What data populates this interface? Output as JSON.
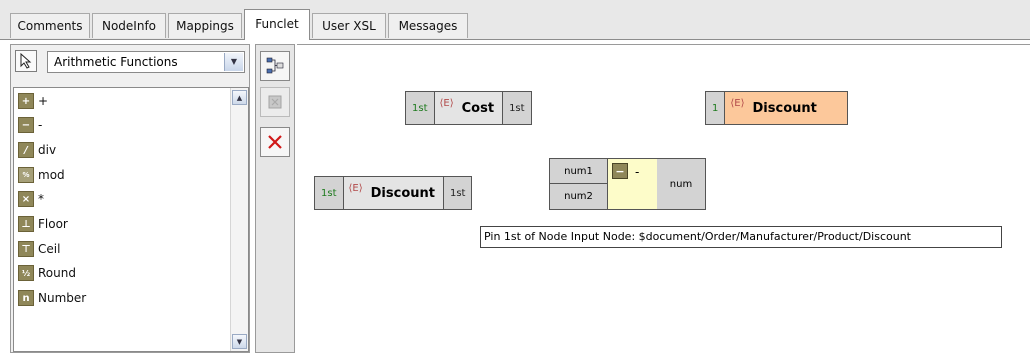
{
  "tabs": [
    {
      "label": "Comments",
      "active": false
    },
    {
      "label": "NodeInfo",
      "active": false
    },
    {
      "label": "Mappings",
      "active": false
    },
    {
      "label": "Funclet",
      "active": true
    },
    {
      "label": "User XSL",
      "active": false
    },
    {
      "label": "Messages",
      "active": false
    }
  ],
  "function_panel": {
    "pointer_icon": "arrow-pointer-icon",
    "category": "Arithmetic Functions",
    "items": [
      {
        "label": "+",
        "icon": "plus-icon"
      },
      {
        "label": "-",
        "icon": "minus-icon"
      },
      {
        "label": "div",
        "icon": "div-icon"
      },
      {
        "label": "mod",
        "icon": "mod-icon"
      },
      {
        "label": "*",
        "icon": "multiply-icon"
      },
      {
        "label": "Floor",
        "icon": "floor-icon"
      },
      {
        "label": "Ceil",
        "icon": "ceil-icon"
      },
      {
        "label": "Round",
        "icon": "round-icon"
      },
      {
        "label": "Number",
        "icon": "number-icon"
      }
    ]
  },
  "toolbar": {
    "buttons": [
      "auto-layout-icon",
      "disabled-tool-icon",
      "delete-x-icon"
    ]
  },
  "canvas": {
    "cost_node": {
      "in_pin": "1st",
      "tag": "⟨E⟩",
      "title": "Cost",
      "out_pin": "1st"
    },
    "discount_target": {
      "in_pin": "1",
      "tag": "⟨E⟩",
      "title": "Discount"
    },
    "discount_source": {
      "in_pin": "1st",
      "tag": "⟨E⟩",
      "title": "Discount",
      "out_pin": "1st"
    },
    "minus_function": {
      "input1": "num1",
      "input2": "num2",
      "symbol": "-",
      "output": "num"
    },
    "tooltip": "Pin 1st of Node Input Node: $document/Order/Manufacturer/Product/Discount"
  },
  "colors": {
    "target_node_fill": "#fcc89b",
    "function_fill": "#fdfcc9",
    "pin_fill": "#d3d3d3",
    "icon_fill": "#8f8759"
  }
}
